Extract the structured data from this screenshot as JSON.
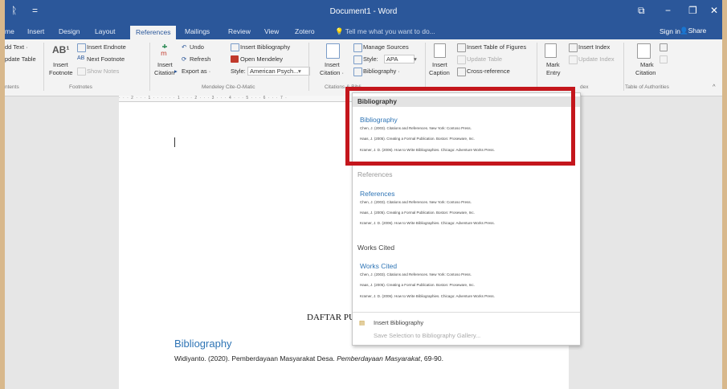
{
  "window": {
    "title": "Document1 - Word",
    "quick_access": [
      "ᚱ",
      "="
    ],
    "controls": {
      "restore": "⧉",
      "minimize": "−",
      "maximize": "❐",
      "close": "✕"
    }
  },
  "tabs": [
    "me",
    "Insert",
    "Design",
    "Layout",
    "References",
    "Mailings",
    "Review",
    "View",
    "Zotero"
  ],
  "tell_me": "Tell me what you want to do...",
  "sign_in": "Sign in",
  "share": "Share",
  "ribbon": {
    "toc": {
      "add_text": "dd Text ·",
      "update_table": "pdate Table",
      "group": "ntents"
    },
    "footnotes": {
      "insert_footnote": [
        "Insert",
        "Footnote"
      ],
      "ab_glyph": "AB¹",
      "insert_endnote": "Insert Endnote",
      "next_footnote": "Next Footnote",
      "show_notes": "Show Notes",
      "group": "Footnotes"
    },
    "mendeley": {
      "insert_citation": [
        "Insert",
        "Citation"
      ],
      "undo": "Undo",
      "refresh": "Refresh",
      "export_as": "Export as ·",
      "insert_bibliography": "Insert Bibliography",
      "open_mendeley": "Open Mendeley",
      "style_label": "Style:",
      "style_value": "American Psych...",
      "group": "Mendeley Cite-O-Matic"
    },
    "citations": {
      "insert_citation": [
        "Insert",
        "Citation ·"
      ],
      "manage_sources": "Manage Sources",
      "style_label": "Style:",
      "style_value": "APA",
      "bibliography": "Bibliography ·",
      "group": "Citations & Bibli..."
    },
    "captions": {
      "insert_caption": [
        "Insert",
        "Caption"
      ],
      "insert_table_of_figures": "Insert Table of Figures",
      "update_table": "Update Table",
      "cross_reference": "Cross-reference"
    },
    "index": {
      "mark_entry": [
        "Mark",
        "Entry"
      ],
      "insert_index": "Insert Index",
      "update_index": "Update Index",
      "group": "dex"
    },
    "authorities": {
      "mark_citation": [
        "Mark",
        "Citation"
      ],
      "group": "Table of Authorities"
    }
  },
  "ruler": "· · · 2 · · · 1 · · · · · · 1 · · · 2 · · · 3 · · · 4 · · · 5 · · · 6 · · · 7 ·",
  "document": {
    "daftar_heading": "DAFTAR PU",
    "bib_heading": "Bibliography",
    "bib_entry_plain": "Widiyanto. (2020). Pemberdayaan Masyarakat Desa. ",
    "bib_entry_italic": "Pemberdayaan Masyarakat",
    "bib_entry_tail": ", 69-90."
  },
  "bibliography_menu": {
    "section_title": "Bibliography",
    "entries": [
      {
        "heading": "Bibliography",
        "lines": [
          "Chen, J. (2003). Citations and References. New York: Contoso Press.",
          "Haas, J. (2005). Creating a Formal Publication. Boston: Proseware, Inc.",
          "Kramer, J. D. (2006). How to Write Bibliographies. Chicago: Adventure Works Press."
        ]
      },
      {
        "label": "References",
        "heading": "References",
        "lines": [
          "Chen, J. (2003). Citations and References. New York: Contoso Press.",
          "Haas, J. (2005). Creating a Formal Publication. Boston: Proseware, Inc.",
          "Kramer, J. D. (2006). How to Write Bibliographies. Chicago: Adventure Works Press."
        ]
      },
      {
        "label": "Works Cited",
        "heading": "Works Cited",
        "lines": [
          "Chen, J. (2003). Citations and References. New York: Contoso Press.",
          "Haas, J. (2005). Creating a Formal Publication. Boston: Proseware, Inc.",
          "Kramer, J. D. (2006). How to Write Bibliographies. Chicago: Adventure Works Press."
        ]
      }
    ],
    "insert_bibliography": "Insert Bibliography",
    "save_selection": "Save Selection to Bibliography Gallery..."
  },
  "colors": {
    "word_blue": "#2b579a",
    "heading_blue": "#2e74b5",
    "highlight_red": "#c4161c"
  }
}
